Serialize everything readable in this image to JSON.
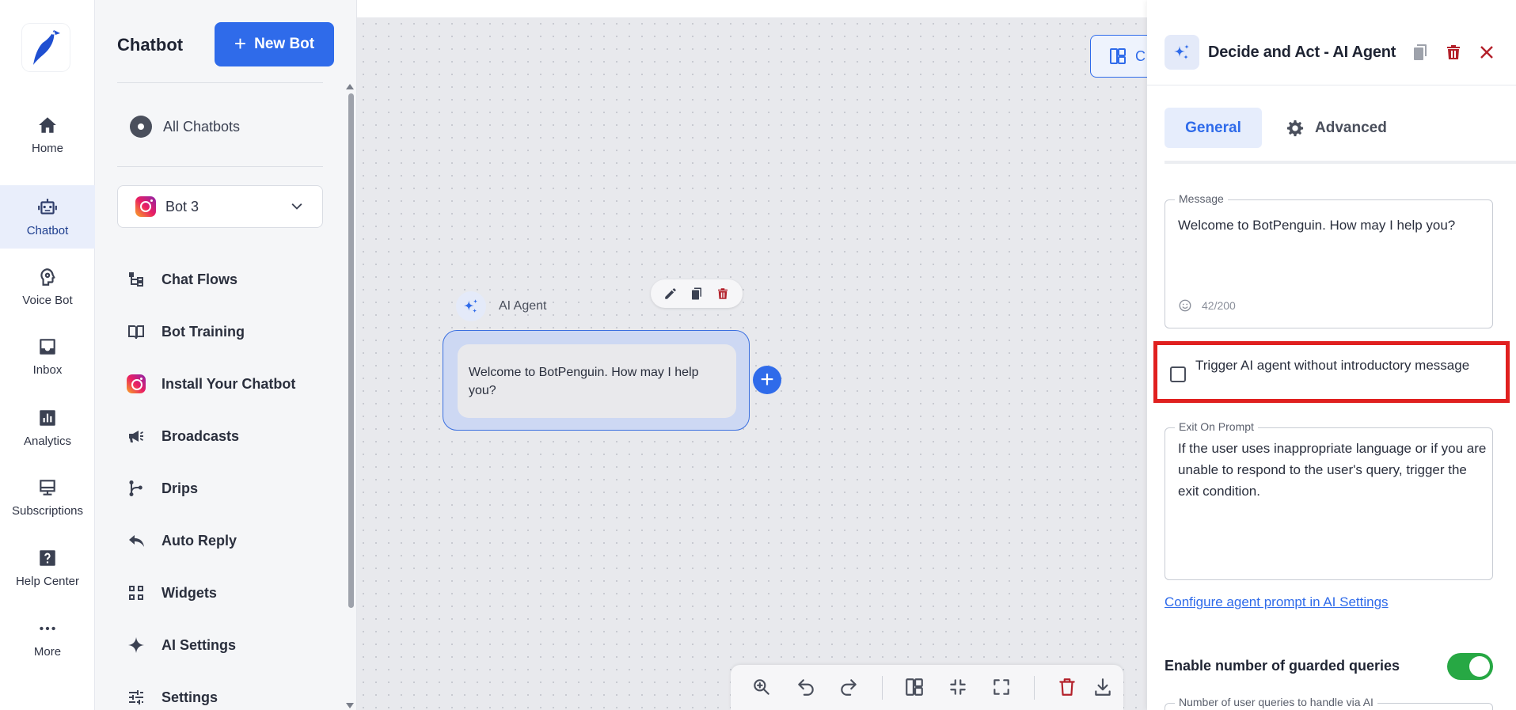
{
  "rail": {
    "items": [
      {
        "label": "Home"
      },
      {
        "label": "Chatbot"
      },
      {
        "label": "Voice Bot"
      },
      {
        "label": "Inbox"
      },
      {
        "label": "Analytics"
      },
      {
        "label": "Subscriptions"
      },
      {
        "label": "Help Center"
      },
      {
        "label": "More"
      }
    ]
  },
  "sidebar": {
    "title": "Chatbot",
    "new_bot_label": "New Bot",
    "all_chatbots": "All Chatbots",
    "selected_bot": "Bot 3",
    "menu": [
      {
        "label": "Chat Flows",
        "icon": "flow-icon"
      },
      {
        "label": "Bot Training",
        "icon": "book-icon"
      },
      {
        "label": "Install Your Chatbot",
        "icon": "instagram-icon"
      },
      {
        "label": "Broadcasts",
        "icon": "megaphone-icon"
      },
      {
        "label": "Drips",
        "icon": "branch-icon"
      },
      {
        "label": "Auto Reply",
        "icon": "reply-icon"
      },
      {
        "label": "Widgets",
        "icon": "grid-icon"
      },
      {
        "label": "AI Settings",
        "icon": "sparkle-icon"
      },
      {
        "label": "Settings",
        "icon": "sliders-icon"
      }
    ]
  },
  "canvas": {
    "top_button_label": "C",
    "node": {
      "header": "AI Agent",
      "message": "Welcome to BotPenguin. How may I help you?"
    }
  },
  "panel": {
    "title": "Decide and Act - AI Agent",
    "tabs": {
      "general": "General",
      "advanced": "Advanced"
    },
    "message": {
      "legend": "Message",
      "value": "Welcome to BotPenguin. How may I help you?",
      "counter": "42/200"
    },
    "trigger": {
      "label": "Trigger AI agent without introductory message"
    },
    "exit_prompt": {
      "legend": "Exit On Prompt",
      "value": "If the user uses inappropriate language or if you are unable to respond to the user's query, trigger the exit condition."
    },
    "config_link": "Configure agent prompt in AI Settings",
    "guarded": {
      "label": "Enable number of guarded queries",
      "field_legend": "Number of user queries to handle via AI"
    }
  },
  "colors": {
    "primary": "#2f6bea",
    "highlight": "#e0201f",
    "toggle_on": "#27a844",
    "delete": "#b3202a"
  }
}
